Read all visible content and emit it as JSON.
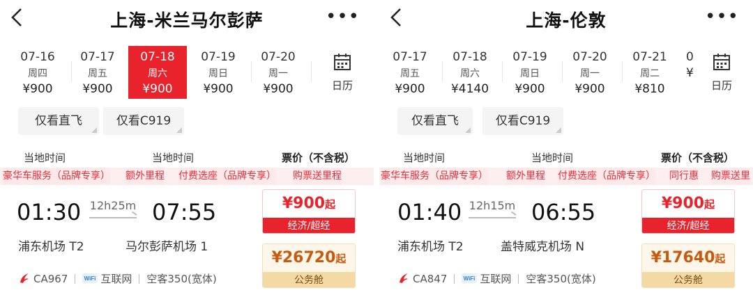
{
  "left": {
    "title": "上海-米兰马尔彭萨",
    "dates": [
      {
        "date": "07-16",
        "weekday": "周四",
        "price": "¥900"
      },
      {
        "date": "07-17",
        "weekday": "周五",
        "price": "¥900"
      },
      {
        "date": "07-18",
        "weekday": "周六",
        "price": "¥900"
      },
      {
        "date": "07-19",
        "weekday": "周日",
        "price": "¥900"
      },
      {
        "date": "07-20",
        "weekday": "周一",
        "price": "¥900"
      }
    ],
    "selected_date": "07-18",
    "calendar_label": "日历",
    "filters": [
      "仅看直飞",
      "仅看C919"
    ],
    "col_local_time_1": "当地时间",
    "col_local_time_2": "当地时间",
    "col_price": "票价（不含税）",
    "tags": [
      "豪华车服务（品牌专享）",
      "额外里程",
      "付费选座（品牌专享）",
      "购票送里程"
    ],
    "flight": {
      "depart_time": "01:30",
      "duration": "12h25m",
      "arrive_time": "07:55",
      "depart_airport": "浦东机场 T2",
      "arrive_airport": "马尔彭萨机场 1",
      "flight_no": "CA967",
      "wifi": "互联网",
      "aircraft": "空客350(宽体)",
      "economy_price": "¥900",
      "economy_suffix": "起",
      "economy_class": "经济/超经",
      "business_price": "¥26720",
      "business_suffix": "起",
      "business_class": "公务舱"
    }
  },
  "right": {
    "title": "上海-伦敦",
    "dates": [
      {
        "date": "07-17",
        "weekday": "周五",
        "price": "¥900"
      },
      {
        "date": "07-18",
        "weekday": "周六",
        "price": "¥4140"
      },
      {
        "date": "07-19",
        "weekday": "周日",
        "price": "¥900"
      },
      {
        "date": "07-20",
        "weekday": "周一",
        "price": "¥900"
      },
      {
        "date": "07-21",
        "weekday": "周二",
        "price": "¥810"
      },
      {
        "date": "0",
        "weekday": "",
        "price": "¥"
      }
    ],
    "calendar_label": "日历",
    "filters": [
      "仅看直飞",
      "仅看C919"
    ],
    "col_local_time_1": "当地时间",
    "col_local_time_2": "当地时间",
    "col_price": "票价（不含税）",
    "tags": [
      "豪华车服务（品牌专享）",
      "额外里程",
      "付费选座（品牌专享）",
      "同行惠",
      "购票送里"
    ],
    "flight": {
      "depart_time": "01:40",
      "duration": "12h15m",
      "arrive_time": "06:55",
      "depart_airport": "浦东机场 T2",
      "arrive_airport": "盖特威克机场 N",
      "flight_no": "CA847",
      "wifi": "互联网",
      "aircraft": "空客350(宽体)",
      "economy_price": "¥900",
      "economy_suffix": "起",
      "economy_class": "经济/超经",
      "business_price": "¥17640",
      "business_suffix": "起",
      "business_class": "公务舱"
    }
  },
  "colors": {
    "accent_red": "#e8232b",
    "business_gold": "#f3d9a4",
    "tag_pink": "#fde8ea"
  },
  "icons": [
    "back-arrow-icon",
    "more-icon",
    "calendar-icon",
    "air-china-logo-icon",
    "wifi-icon"
  ]
}
